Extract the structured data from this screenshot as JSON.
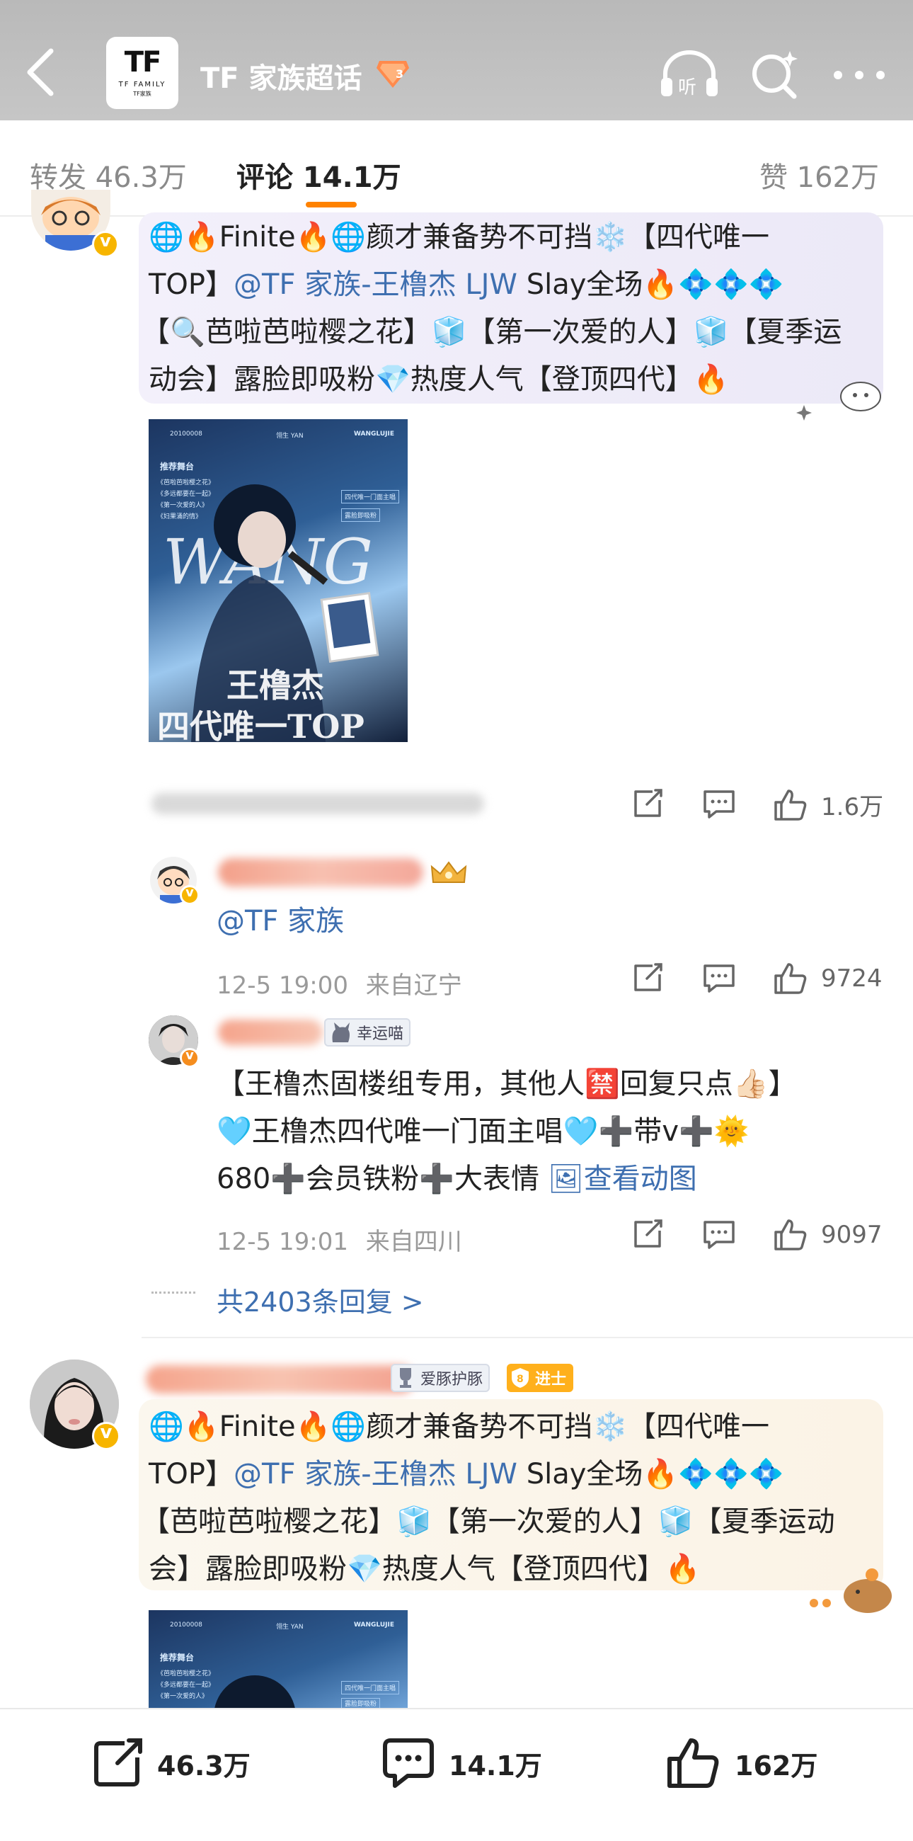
{
  "header": {
    "logo_text": "TF",
    "logo_sub": "TF FAMILY",
    "logo_sub2": "TF家族",
    "title": "TF 家族超话",
    "badge_level": "3"
  },
  "tabs": {
    "repost": "转发 46.3万",
    "comments": "评论 14.1万",
    "likes": "赞 162万"
  },
  "comment1": {
    "line1": "🌐🔥Finite🔥🌐颜才兼备势不可挡❄️【四代唯一",
    "line2_a": "TOP】",
    "line2_mention": "@TF 家族-王橹杰 LJW",
    "line2_b": " Slay全场🔥💠💠💠",
    "line3": "【🔍芭啦芭啦樱之花】🧊【第一次爱的人】🧊【夏季运",
    "line4": "动会】露脸即吸粉💎热度人气【登顶四代】🔥",
    "photo": {
      "top_date": "20100008",
      "top_mid": "翎生 YAN",
      "top_right": "WANGLUJIE",
      "side_title": "推荐舞台",
      "side1": "《芭啦芭啦樱之花》",
      "side2": "《多远都要在一起》",
      "side3": "《第一次爱的人》",
      "side4": "《妇果涌的情》",
      "r1": "四代唯一门面主唱",
      "r2": "露脸即吸粉",
      "big": "WANG",
      "cn1": "王橹杰",
      "cn2": "四代唯一TOP"
    },
    "likes": "1.6万"
  },
  "reply1": {
    "text": "@TF 家族",
    "time": "12-5 19:00",
    "location": "来自辽宁",
    "likes": "9724"
  },
  "reply2": {
    "tag": "幸运喵",
    "line1": "【王橹杰固楼组专用，其他人🈲回复只点👍🏻】",
    "line2": "🩵王橹杰四代唯一门面主唱🩵➕带v➕🌞",
    "line3_a": "680➕会员铁粉➕大表情",
    "line3_link": "🖼查看动图",
    "time": "12-5 19:01",
    "location": "来自四川",
    "likes": "9097"
  },
  "reply_total": "共2403条回复 >",
  "comment2": {
    "tag1": "爱豚护豚",
    "tag2_level": "8",
    "tag2": "进士",
    "line1": "🌐🔥Finite🔥🌐颜才兼备势不可挡❄️【四代唯一",
    "line2_a": "TOP】",
    "line2_mention": "@TF 家族-王橹杰 LJW",
    "line2_b": " Slay全场🔥💠💠💠",
    "line3": "【芭啦芭啦樱之花】🧊【第一次爱的人】🧊【夏季运动",
    "line4": "会】露脸即吸粉💎热度人气【登顶四代】🔥",
    "photo": {
      "top_date": "20100008",
      "top_mid": "翎生 YAN",
      "top_right": "WANGLUJIE",
      "side_title": "推荐舞台",
      "side1": "《芭啦芭啦樱之花》",
      "side2": "《多远都要在一起》",
      "side3": "《第一次爱的人》",
      "r1": "四代唯一门面主唱",
      "r2": "露脸即吸粉"
    }
  },
  "bottom_bar": {
    "repost": "46.3万",
    "comments": "14.1万",
    "likes": "162万"
  },
  "colors": {
    "accent": "#ff8200",
    "link": "#3e6fb0",
    "verified": "#f7b500"
  }
}
